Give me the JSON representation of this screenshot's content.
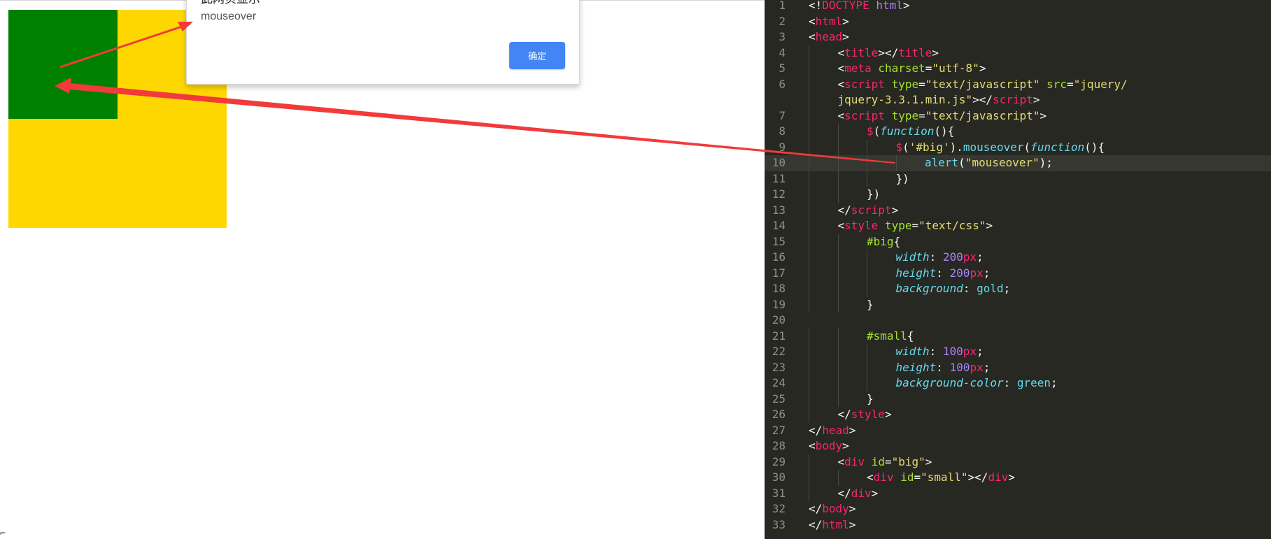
{
  "colors": {
    "big": "#ffd700",
    "small": "#008000",
    "ok_button": "#4285f4",
    "editor_bg": "#272822",
    "arrow": "#f23a3a",
    "syn_tag": "#f92672",
    "syn_attr": "#a6e22e",
    "syn_string": "#e6db74",
    "syn_number": "#ae81ff",
    "syn_keyword": "#66d9ef",
    "syn_plain": "#f8f8f2"
  },
  "alert": {
    "title": "此网页显示",
    "message": "mouseover",
    "ok_label": "确定"
  },
  "preview": {
    "cursor_glyph": "⌐"
  },
  "editor": {
    "active_line": 10,
    "lines": [
      {
        "n": "1",
        "indent": 0,
        "t": [
          [
            "plain",
            "<!"
          ],
          [
            "tag",
            "DOCTYPE"
          ],
          [
            "plain",
            " "
          ],
          [
            "num",
            "html"
          ],
          [
            "plain",
            ">"
          ]
        ]
      },
      {
        "n": "2",
        "indent": 0,
        "t": [
          [
            "plain",
            "<"
          ],
          [
            "tag",
            "html"
          ],
          [
            "plain",
            ">"
          ]
        ]
      },
      {
        "n": "3",
        "indent": 0,
        "t": [
          [
            "plain",
            "<"
          ],
          [
            "tag",
            "head"
          ],
          [
            "plain",
            ">"
          ]
        ]
      },
      {
        "n": "4",
        "indent": 1,
        "t": [
          [
            "plain",
            "<"
          ],
          [
            "tag",
            "title"
          ],
          [
            "plain",
            "></"
          ],
          [
            "tag",
            "title"
          ],
          [
            "plain",
            ">"
          ]
        ]
      },
      {
        "n": "5",
        "indent": 1,
        "t": [
          [
            "plain",
            "<"
          ],
          [
            "tag",
            "meta"
          ],
          [
            "plain",
            " "
          ],
          [
            "attr",
            "charset"
          ],
          [
            "plain",
            "="
          ],
          [
            "str",
            "\"utf-8\""
          ],
          [
            "plain",
            ">"
          ]
        ]
      },
      {
        "n": "6",
        "indent": 1,
        "t": [
          [
            "plain",
            "<"
          ],
          [
            "tag",
            "script"
          ],
          [
            "plain",
            " "
          ],
          [
            "attr",
            "type"
          ],
          [
            "plain",
            "="
          ],
          [
            "str",
            "\"text/javascript\""
          ],
          [
            "plain",
            " "
          ],
          [
            "attr",
            "src"
          ],
          [
            "plain",
            "="
          ],
          [
            "str",
            "\"jquery/"
          ]
        ]
      },
      {
        "n": "",
        "indent": 1,
        "t": [
          [
            "str",
            "jquery-3.3.1.min.js\""
          ],
          [
            "plain",
            "></"
          ],
          [
            "tag",
            "script"
          ],
          [
            "plain",
            ">"
          ]
        ]
      },
      {
        "n": "7",
        "indent": 1,
        "t": [
          [
            "plain",
            "<"
          ],
          [
            "tag",
            "script"
          ],
          [
            "plain",
            " "
          ],
          [
            "attr",
            "type"
          ],
          [
            "plain",
            "="
          ],
          [
            "str",
            "\"text/javascript\""
          ],
          [
            "plain",
            ">"
          ]
        ]
      },
      {
        "n": "8",
        "indent": 2,
        "t": [
          [
            "tag",
            "$"
          ],
          [
            "plain",
            "("
          ],
          [
            "kwi",
            "function"
          ],
          [
            "plain",
            "(){"
          ]
        ]
      },
      {
        "n": "9",
        "indent": 3,
        "t": [
          [
            "tag",
            "$"
          ],
          [
            "plain",
            "("
          ],
          [
            "str",
            "'#big'"
          ],
          [
            "plain",
            ")."
          ],
          [
            "kw",
            "mouseover"
          ],
          [
            "plain",
            "("
          ],
          [
            "kwi",
            "function"
          ],
          [
            "plain",
            "(){"
          ]
        ]
      },
      {
        "n": "10",
        "indent": 4,
        "t": [
          [
            "kw",
            "alert"
          ],
          [
            "plain",
            "("
          ],
          [
            "str",
            "\"mouseover\""
          ],
          [
            "plain",
            ");"
          ]
        ]
      },
      {
        "n": "11",
        "indent": 3,
        "t": [
          [
            "plain",
            "})"
          ]
        ]
      },
      {
        "n": "12",
        "indent": 2,
        "t": [
          [
            "plain",
            "})"
          ]
        ]
      },
      {
        "n": "13",
        "indent": 1,
        "t": [
          [
            "plain",
            "</"
          ],
          [
            "tag",
            "script"
          ],
          [
            "plain",
            ">"
          ]
        ]
      },
      {
        "n": "14",
        "indent": 1,
        "t": [
          [
            "plain",
            "<"
          ],
          [
            "tag",
            "style"
          ],
          [
            "plain",
            " "
          ],
          [
            "attr",
            "type"
          ],
          [
            "plain",
            "="
          ],
          [
            "str",
            "\"text/css\""
          ],
          [
            "plain",
            ">"
          ]
        ]
      },
      {
        "n": "15",
        "indent": 2,
        "t": [
          [
            "attr",
            "#big"
          ],
          [
            "plain",
            "{"
          ]
        ]
      },
      {
        "n": "16",
        "indent": 3,
        "t": [
          [
            "kwi",
            "width"
          ],
          [
            "plain",
            ": "
          ],
          [
            "num",
            "200"
          ],
          [
            "tag",
            "px"
          ],
          [
            "plain",
            ";"
          ]
        ]
      },
      {
        "n": "17",
        "indent": 3,
        "t": [
          [
            "kwi",
            "height"
          ],
          [
            "plain",
            ": "
          ],
          [
            "num",
            "200"
          ],
          [
            "tag",
            "px"
          ],
          [
            "plain",
            ";"
          ]
        ]
      },
      {
        "n": "18",
        "indent": 3,
        "t": [
          [
            "kwi",
            "background"
          ],
          [
            "plain",
            ": "
          ],
          [
            "kw",
            "gold"
          ],
          [
            "plain",
            ";"
          ]
        ]
      },
      {
        "n": "19",
        "indent": 2,
        "t": [
          [
            "plain",
            "}"
          ]
        ]
      },
      {
        "n": "20",
        "indent": 0,
        "t": []
      },
      {
        "n": "21",
        "indent": 2,
        "t": [
          [
            "attr",
            "#small"
          ],
          [
            "plain",
            "{"
          ]
        ]
      },
      {
        "n": "22",
        "indent": 3,
        "t": [
          [
            "kwi",
            "width"
          ],
          [
            "plain",
            ": "
          ],
          [
            "num",
            "100"
          ],
          [
            "tag",
            "px"
          ],
          [
            "plain",
            ";"
          ]
        ]
      },
      {
        "n": "23",
        "indent": 3,
        "t": [
          [
            "kwi",
            "height"
          ],
          [
            "plain",
            ": "
          ],
          [
            "num",
            "100"
          ],
          [
            "tag",
            "px"
          ],
          [
            "plain",
            ";"
          ]
        ]
      },
      {
        "n": "24",
        "indent": 3,
        "t": [
          [
            "kwi",
            "background-color"
          ],
          [
            "plain",
            ": "
          ],
          [
            "kw",
            "green"
          ],
          [
            "plain",
            ";"
          ]
        ]
      },
      {
        "n": "25",
        "indent": 2,
        "t": [
          [
            "plain",
            "}"
          ]
        ]
      },
      {
        "n": "26",
        "indent": 1,
        "t": [
          [
            "plain",
            "</"
          ],
          [
            "tag",
            "style"
          ],
          [
            "plain",
            ">"
          ]
        ]
      },
      {
        "n": "27",
        "indent": 0,
        "t": [
          [
            "plain",
            "</"
          ],
          [
            "tag",
            "head"
          ],
          [
            "plain",
            ">"
          ]
        ]
      },
      {
        "n": "28",
        "indent": 0,
        "t": [
          [
            "plain",
            "<"
          ],
          [
            "tag",
            "body"
          ],
          [
            "plain",
            ">"
          ]
        ]
      },
      {
        "n": "29",
        "indent": 1,
        "t": [
          [
            "plain",
            "<"
          ],
          [
            "tag",
            "div"
          ],
          [
            "plain",
            " "
          ],
          [
            "attr",
            "id"
          ],
          [
            "plain",
            "="
          ],
          [
            "str",
            "\"big\""
          ],
          [
            "plain",
            ">"
          ]
        ]
      },
      {
        "n": "30",
        "indent": 2,
        "t": [
          [
            "plain",
            "<"
          ],
          [
            "tag",
            "div"
          ],
          [
            "plain",
            " "
          ],
          [
            "attr",
            "id"
          ],
          [
            "plain",
            "="
          ],
          [
            "str",
            "\"small\""
          ],
          [
            "plain",
            "></"
          ],
          [
            "tag",
            "div"
          ],
          [
            "plain",
            ">"
          ]
        ]
      },
      {
        "n": "31",
        "indent": 1,
        "t": [
          [
            "plain",
            "</"
          ],
          [
            "tag",
            "div"
          ],
          [
            "plain",
            ">"
          ]
        ]
      },
      {
        "n": "32",
        "indent": 0,
        "t": [
          [
            "plain",
            "</"
          ],
          [
            "tag",
            "body"
          ],
          [
            "plain",
            ">"
          ]
        ]
      },
      {
        "n": "33",
        "indent": 0,
        "t": [
          [
            "plain",
            "</"
          ],
          [
            "tag",
            "html"
          ],
          [
            "plain",
            ">"
          ]
        ]
      }
    ]
  }
}
